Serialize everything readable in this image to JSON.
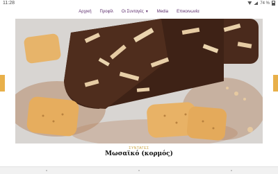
{
  "status": {
    "time": "11:28",
    "battery": "74 %"
  },
  "nav": {
    "items": [
      {
        "label": "Αρχική",
        "has_dropdown": false
      },
      {
        "label": "Προφίλ",
        "has_dropdown": false
      },
      {
        "label": "Οι Συνταγές",
        "has_dropdown": true
      },
      {
        "label": "Media",
        "has_dropdown": false
      },
      {
        "label": "Επικοινωνία",
        "has_dropdown": false
      }
    ]
  },
  "post": {
    "category": "ΣΥΝΤΑΓΕΣ",
    "title": "Μωσαϊκό (κορμός)"
  },
  "colors": {
    "accent": "#e8b04a",
    "nav_text": "#5a2a6a",
    "category": "#c9a13c"
  }
}
